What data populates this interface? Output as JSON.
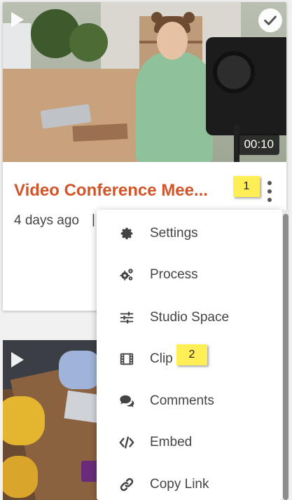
{
  "video_card": {
    "title": "Video Conference Mee...",
    "duration": "00:10",
    "uploaded": "4 days ago",
    "separator": "|"
  },
  "menu": {
    "items": [
      {
        "label": "Settings",
        "icon": "gear-icon"
      },
      {
        "label": "Process",
        "icon": "gears-icon"
      },
      {
        "label": "Studio Space",
        "icon": "sliders-icon"
      },
      {
        "label": "Clip",
        "icon": "film-icon"
      },
      {
        "label": "Comments",
        "icon": "comments-icon"
      },
      {
        "label": "Embed",
        "icon": "code-icon"
      },
      {
        "label": "Copy Link",
        "icon": "link-icon"
      }
    ]
  },
  "annotations": {
    "first": "1",
    "second": "2"
  },
  "colors": {
    "title": "#d2552a",
    "annotation": "#ffee55",
    "icon": "#444444"
  }
}
